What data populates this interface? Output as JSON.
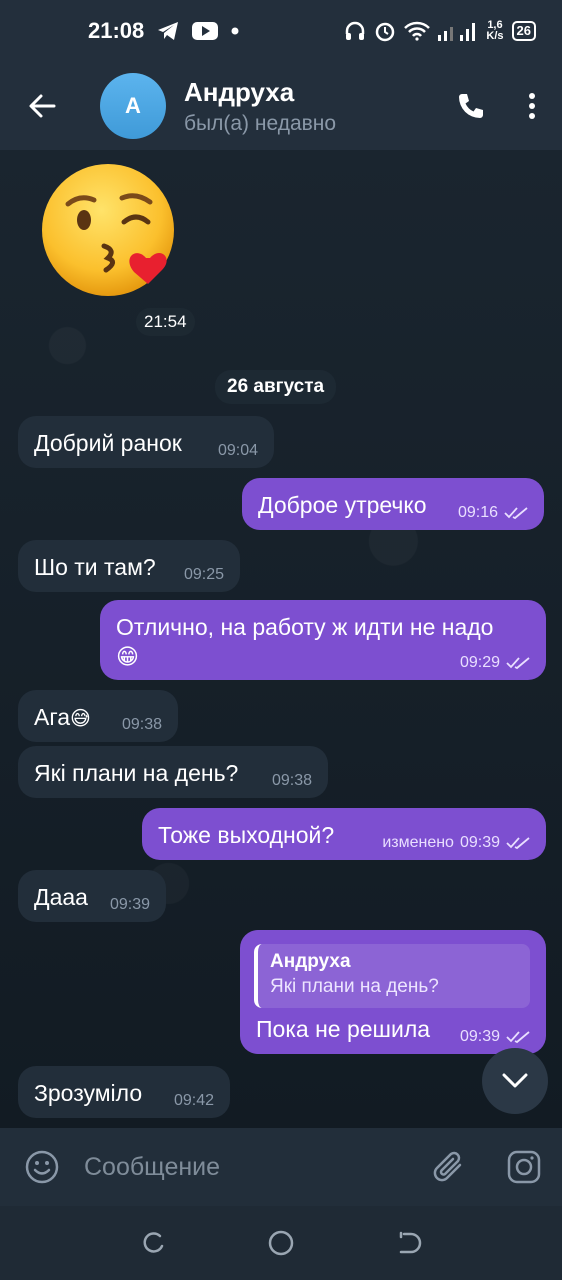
{
  "status_bar": {
    "time": "21:08",
    "net_speed_value": "1,6",
    "net_speed_unit": "K/s",
    "battery": "26",
    "icons": [
      "telegram-icon",
      "youtube-icon",
      "dot-icon",
      "headphones-icon",
      "alarm-icon",
      "wifi-icon",
      "signal-icon"
    ]
  },
  "header": {
    "avatar_letter": "A",
    "contact_name": "Андруха",
    "contact_status": "был(а) недавно",
    "icons": [
      "back-arrow-icon",
      "phone-icon",
      "more-vert-icon"
    ]
  },
  "chat": {
    "sticker": {
      "emoji": "😘",
      "time": "21:54"
    },
    "date_separator": "26 августа",
    "messages": [
      {
        "dir": "in",
        "text": "Добрий ранок",
        "time": "09:04"
      },
      {
        "dir": "out",
        "text": "Доброе утречко",
        "time": "09:16",
        "read": true
      },
      {
        "dir": "in",
        "text": "Шо ти там?",
        "time": "09:25"
      },
      {
        "dir": "out",
        "text": "Отлично, на работу ж идти не надо",
        "emoji": "😁",
        "time": "09:29",
        "read": true
      },
      {
        "dir": "in",
        "text": "Ага",
        "emoji": "😅",
        "time": "09:38"
      },
      {
        "dir": "in",
        "text": "Які плани на день?",
        "time": "09:38"
      },
      {
        "dir": "out",
        "text": "Тоже выходной?",
        "edited_label": "изменено",
        "time": "09:39",
        "read": true
      },
      {
        "dir": "in",
        "text": "Дааа",
        "time": "09:39"
      },
      {
        "dir": "out",
        "reply_author": "Андруха",
        "reply_text": "Які плани на день?",
        "text": "Пока не решила",
        "time": "09:39",
        "read": true
      },
      {
        "dir": "in",
        "text": "Зрозуміло",
        "time": "09:42"
      }
    ]
  },
  "composer": {
    "placeholder": "Сообщение",
    "icons": [
      "emoji-icon",
      "attach-icon",
      "camera-icon"
    ]
  },
  "colors": {
    "header_bg": "#232f3c",
    "chat_bg": "#152029",
    "incoming_bubble": "#222e3a",
    "outgoing_bubble": "#7d4fd0",
    "avatar": "#4da6e3"
  }
}
